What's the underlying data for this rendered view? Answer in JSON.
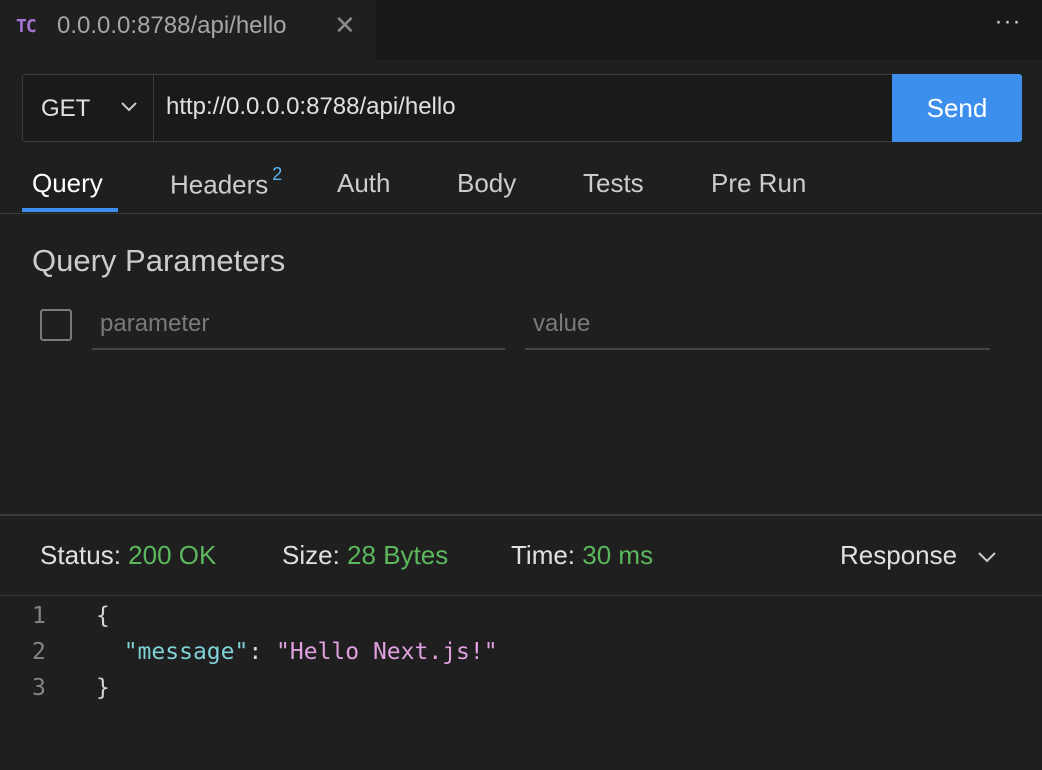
{
  "tab": {
    "icon_text": "TC",
    "title": "0.0.0.0:8788/api/hello",
    "close": "✕"
  },
  "window": {
    "more_icon": "···"
  },
  "request": {
    "method": "GET",
    "url": "http://0.0.0.0:8788/api/hello",
    "send_label": "Send"
  },
  "request_tabs": [
    {
      "label": "Query",
      "active": true
    },
    {
      "label": "Headers",
      "badge": "2"
    },
    {
      "label": "Auth"
    },
    {
      "label": "Body"
    },
    {
      "label": "Tests"
    },
    {
      "label": "Pre Run"
    }
  ],
  "query": {
    "title": "Query Parameters",
    "param_placeholder": "parameter",
    "value_placeholder": "value"
  },
  "response": {
    "status_label": "Status:",
    "status_value": "200 OK",
    "size_label": "Size:",
    "size_value": "28 Bytes",
    "time_label": "Time:",
    "time_value": "30 ms",
    "view_select": "Response",
    "lines": [
      {
        "n": "1",
        "text": "{"
      },
      {
        "n": "2",
        "key": "\"message\"",
        "sep": ": ",
        "val": "\"Hello Next.js!\""
      },
      {
        "n": "3",
        "text": "}"
      }
    ]
  },
  "colors": {
    "accent": "#3d8fee",
    "success": "#5cb85c",
    "badge": "#5bb4f0",
    "tab_icon": "#a475d4"
  }
}
